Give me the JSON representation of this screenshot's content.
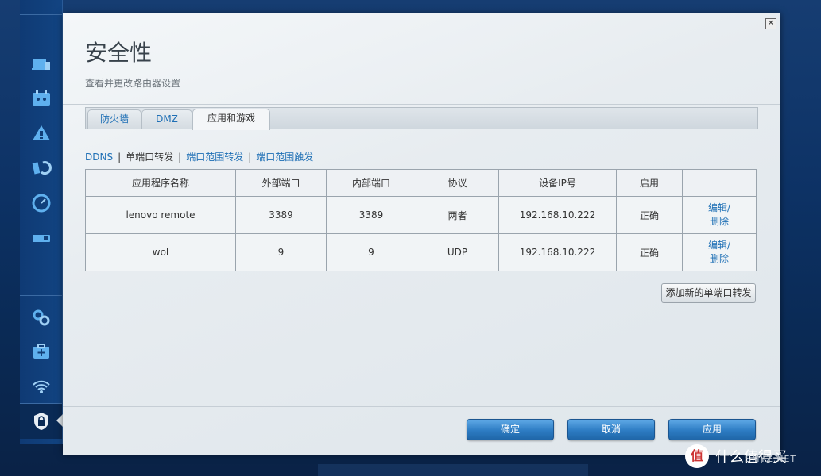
{
  "dialog": {
    "title": "安全性",
    "subtitle": "查看并更改路由器设置",
    "close_label": "✕"
  },
  "tabs": [
    {
      "label": "防火墙",
      "active": false
    },
    {
      "label": "DMZ",
      "active": false
    },
    {
      "label": "应用和游戏",
      "active": true
    }
  ],
  "sublinks": [
    {
      "label": "DDNS",
      "active": false
    },
    {
      "label": "单端口转发",
      "active": true
    },
    {
      "label": "端口范围转发",
      "active": false
    },
    {
      "label": "端口范围触发",
      "active": false
    }
  ],
  "table": {
    "headers": [
      "应用程序名称",
      "外部端口",
      "内部端口",
      "协议",
      "设备IP号",
      "启用",
      ""
    ],
    "rows": [
      {
        "name": "lenovo remote",
        "external": "3389",
        "internal": "3389",
        "protocol": "两者",
        "ip": "192.168.10.222",
        "enabled": "正确",
        "edit": "编辑/",
        "delete": "删除"
      },
      {
        "name": "wol",
        "external": "9",
        "internal": "9",
        "protocol": "UDP",
        "ip": "192.168.10.222",
        "enabled": "正确",
        "edit": "编辑/",
        "delete": "删除"
      }
    ]
  },
  "buttons": {
    "add": "添加新的单端口转发",
    "ok": "确定",
    "cancel": "取消",
    "apply": "应用"
  },
  "sidebar": {
    "icons": [
      "devices-icon",
      "parental-controls-icon",
      "guest-access-icon",
      "media-prioritization-icon",
      "speed-test-icon",
      "usb-storage-icon",
      "settings-icon",
      "troubleshooting-icon",
      "wireless-icon",
      "security-icon"
    ],
    "active": "security-icon"
  },
  "watermark": {
    "logo": "值",
    "text": "什么值得买",
    "site": "SMYZ.NET"
  },
  "colors": {
    "accent": "#1e6fb5",
    "button_blue": "#2d7cc3",
    "sidebar": "#124482"
  }
}
